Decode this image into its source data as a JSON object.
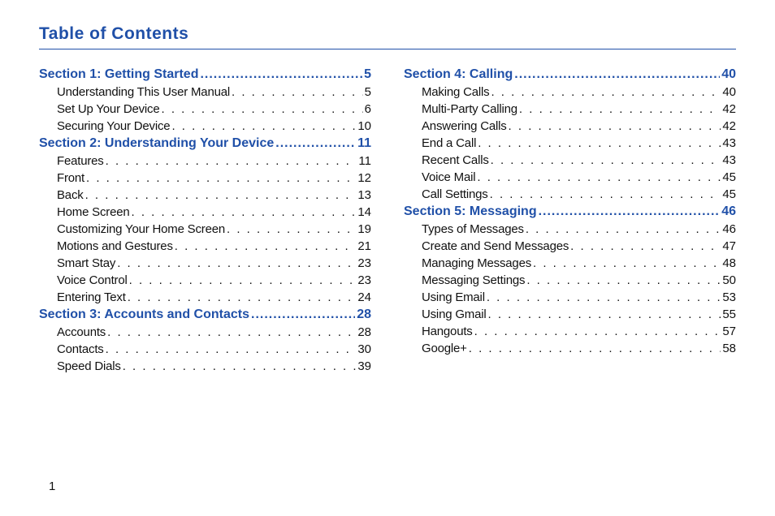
{
  "title": "Table of Contents",
  "page_number": "1",
  "dot_fill": ". . . . . . . . . . . . . . . . . . . . . . . . . . . . . . . . . . . . . . . . . . . . . . . . . . . . . . . . . . . .",
  "head_dot_fill": "...................................................................",
  "columns": [
    {
      "sections": [
        {
          "title": "Section 1:  Getting Started",
          "page": "5",
          "entries": [
            {
              "label": "Understanding This User Manual",
              "page": "5"
            },
            {
              "label": "Set Up Your Device",
              "page": "6"
            },
            {
              "label": "Securing Your Device",
              "page": "10"
            }
          ]
        },
        {
          "title": "Section 2:  Understanding Your Device",
          "page": "11",
          "entries": [
            {
              "label": "Features",
              "page": "11"
            },
            {
              "label": "Front",
              "page": "12"
            },
            {
              "label": "Back",
              "page": "13"
            },
            {
              "label": "Home Screen",
              "page": "14"
            },
            {
              "label": "Customizing Your Home Screen",
              "page": "19"
            },
            {
              "label": "Motions and Gestures",
              "page": "21"
            },
            {
              "label": "Smart Stay",
              "page": "23"
            },
            {
              "label": "Voice Control",
              "page": "23"
            },
            {
              "label": "Entering Text",
              "page": "24"
            }
          ]
        },
        {
          "title": "Section 3:  Accounts and Contacts",
          "page": "28",
          "entries": [
            {
              "label": "Accounts",
              "page": "28"
            },
            {
              "label": "Contacts",
              "page": "30"
            },
            {
              "label": "Speed Dials",
              "page": "39"
            }
          ]
        }
      ]
    },
    {
      "sections": [
        {
          "title": "Section 4:  Calling",
          "page": "40",
          "entries": [
            {
              "label": "Making Calls",
              "page": "40"
            },
            {
              "label": "Multi-Party Calling",
              "page": "42"
            },
            {
              "label": "Answering Calls",
              "page": "42"
            },
            {
              "label": "End a Call",
              "page": "43"
            },
            {
              "label": "Recent Calls",
              "page": "43"
            },
            {
              "label": "Voice Mail",
              "page": "45"
            },
            {
              "label": "Call Settings",
              "page": "45"
            }
          ]
        },
        {
          "title": "Section 5:  Messaging",
          "page": "46",
          "entries": [
            {
              "label": "Types of Messages",
              "page": "46"
            },
            {
              "label": "Create and Send Messages",
              "page": "47"
            },
            {
              "label": "Managing Messages",
              "page": "48"
            },
            {
              "label": "Messaging Settings",
              "page": "50"
            },
            {
              "label": "Using Email",
              "page": "53"
            },
            {
              "label": "Using Gmail",
              "page": "55"
            },
            {
              "label": "Hangouts",
              "page": "57"
            },
            {
              "label": "Google+",
              "page": "58"
            }
          ]
        }
      ]
    }
  ]
}
